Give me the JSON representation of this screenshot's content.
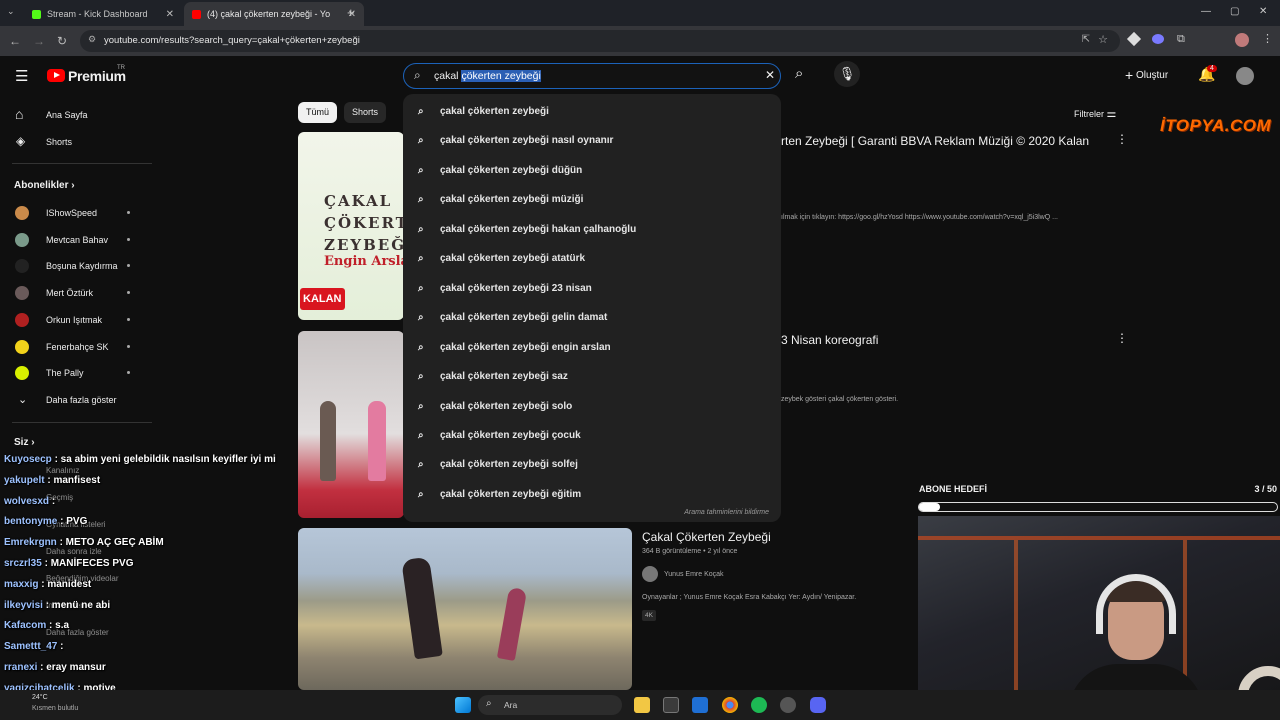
{
  "browser": {
    "tabs": [
      {
        "title": "Stream - Kick Dashboard",
        "fav_color": "#53fc18"
      },
      {
        "title": "(4) çakal çökerten zeybeği - Yo",
        "fav_color": "#ff0000"
      }
    ],
    "url": "youtube.com/results?search_query=çakal+çökerten+zeybeği"
  },
  "youtube": {
    "logo_text": "Premium",
    "logo_region": "TR",
    "search_typed": "çakal",
    "search_selected": "çökerten zeybeği",
    "create_label": "Oluştur",
    "notif_count": "4",
    "filters_label": "Filtreler",
    "chips": [
      "Tümü",
      "Shorts"
    ],
    "sidebar": {
      "home": "Ana Sayfa",
      "shorts": "Shorts",
      "subs_header": "Abonelikler",
      "subs": [
        {
          "name": "IShowSpeed",
          "color": "#c98a4a"
        },
        {
          "name": "Mevtcan Bahav",
          "color": "#7a9a8a"
        },
        {
          "name": "Boşuna Kaydırma",
          "color": "#222222"
        },
        {
          "name": "Mert Öztürk",
          "color": "#6a5a5a"
        },
        {
          "name": "Orkun Işıtmak",
          "color": "#b02020"
        },
        {
          "name": "Fenerbahçe SK",
          "color": "#f2d21b"
        },
        {
          "name": "The Pally",
          "color": "#d8f000"
        }
      ],
      "more": "Daha fazla göster",
      "you_header": "Siz",
      "you_items": [
        "Kanalınız",
        "Geçmiş",
        "Oynatma listeleri",
        "Daha sonra izle",
        "Beğendiğim videolar",
        "İndirilenler",
        "Daha fazla göster"
      ]
    },
    "suggestions": [
      "çakal çökerten zeybeği",
      "çakal çökerten zeybeği nasıl oynanır",
      "çakal çökerten zeybeği düğün",
      "çakal çökerten zeybeği müziği",
      "çakal çökerten zeybeği hakan çalhanoğlu",
      "çakal çökerten zeybeği atatürk",
      "çakal çökerten zeybeği 23 nisan",
      "çakal çökerten zeybeği gelin damat",
      "çakal çökerten zeybeği engin arslan",
      "çakal çökerten zeybeği saz",
      "çakal çökerten zeybeği solo",
      "çakal çökerten zeybeği çocuk",
      "çakal çökerten zeybeği solfej",
      "çakal çökerten zeybeği eğitim"
    ],
    "suggest_footer": "Arama tahminlerini bildirme",
    "results": [
      {
        "title": "rten Zeybeği [ Garanti BBVA Reklam Müziği © 2020 Kalan",
        "desc": "ılmak için tıklayın: https://goo.gl/hzYosd https://www.youtube.com/watch?v=xql_j5i3lwQ ...",
        "thumb_title": "ÇAKAL ÇÖKERTEN ZEYBEĞİ",
        "thumb_sub": "Engin Arslan",
        "thumb_badge": "KALAN"
      },
      {
        "title": "3 Nisan koreografi",
        "desc": "zeybek gösteri çakal çökerten gösteri."
      },
      {
        "title": "Çakal Çökerten Zeybeği",
        "meta": "364 B görüntüleme • 2 yıl önce",
        "channel": "Yunus Emre Koçak",
        "desc": "Oynayanlar ; Yunus Emre Koçak Esra Kabakçı Yer: Aydın/ Yenipazar.",
        "badge": "4K"
      }
    ]
  },
  "overlay": {
    "watermark": "İTOPYA.COM",
    "goal_label": "ABONE HEDEFİ",
    "goal_count": "3 / 50",
    "goal_progress": 0.06,
    "chat": [
      {
        "user": "Kuyosecp",
        "msg": ": sa abim yeni gelebildik nasılsın keyifler iyi mi"
      },
      {
        "user": "yakupelt",
        "msg": ": manfisest"
      },
      {
        "user": "wolvesxd",
        "msg": ":"
      },
      {
        "user": "bentonyme",
        "msg": ": PVG"
      },
      {
        "user": "Emrekrgnn",
        "msg": ": METO AÇ GEÇ ABİM"
      },
      {
        "user": "srczrl35",
        "msg": ": MANİFECES PVG"
      },
      {
        "user": "maxxig",
        "msg": ": manidest"
      },
      {
        "user": "ilkeyvisi",
        "msg": ": menü ne abi"
      },
      {
        "user": "Kafacom",
        "msg": ": s.a"
      },
      {
        "user": "Samettt_47",
        "msg": ":"
      },
      {
        "user": "rranexi",
        "msg": ": eray mansur"
      },
      {
        "user": "yagizcihatcelik",
        "msg": ": motive"
      }
    ]
  },
  "taskbar": {
    "search": "Ara",
    "weather_temp": "24°C",
    "weather_desc": "Kısmen bulutlu"
  }
}
